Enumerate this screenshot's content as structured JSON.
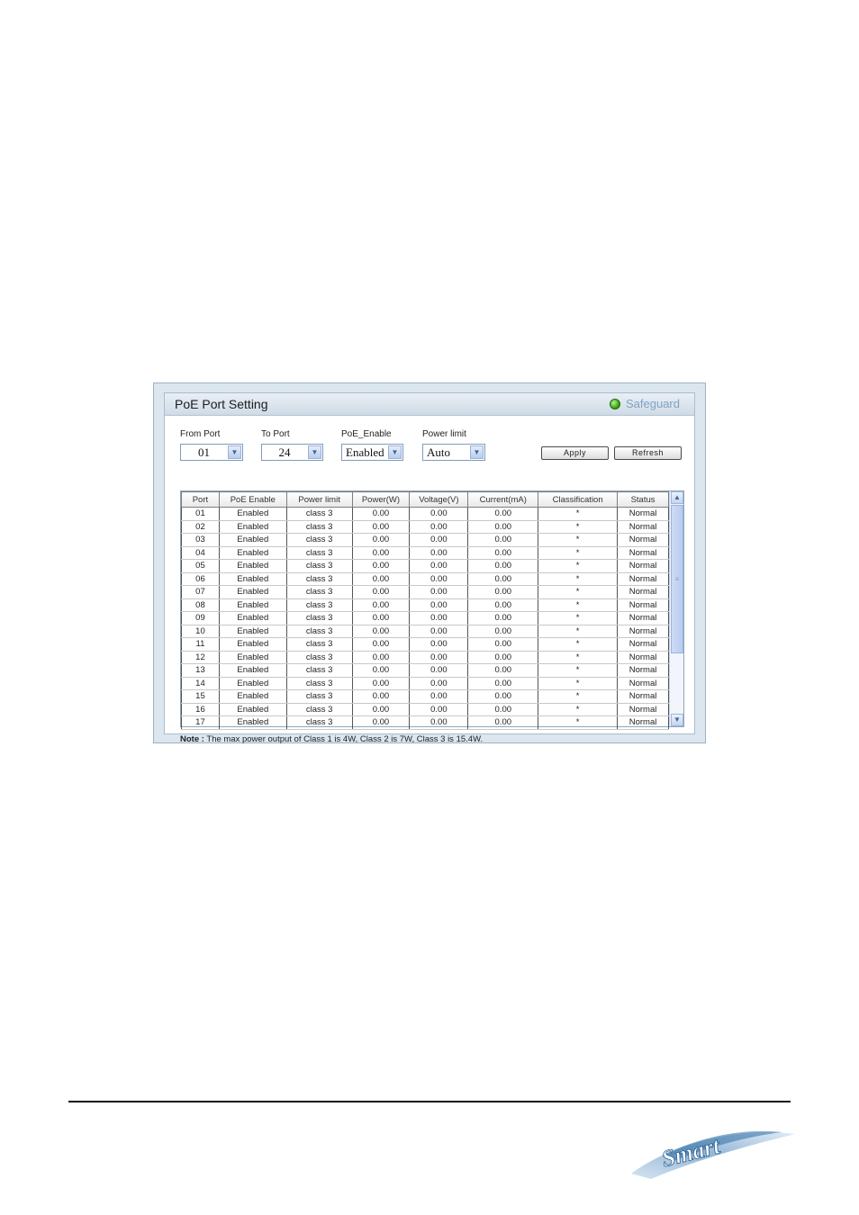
{
  "panel": {
    "title": "PoE Port Setting",
    "safeguard_label": "Safeguard"
  },
  "controls": {
    "from_port": {
      "label": "From Port",
      "value": "01"
    },
    "to_port": {
      "label": "To Port",
      "value": "24"
    },
    "poe_enable": {
      "label": "PoE_Enable",
      "value": "Enabled"
    },
    "power_limit": {
      "label": "Power limit",
      "value": "Auto"
    },
    "apply_label": "Apply",
    "refresh_label": "Refresh"
  },
  "table": {
    "columns": [
      "Port",
      "PoE Enable",
      "Power limit",
      "Power(W)",
      "Voltage(V)",
      "Current(mA)",
      "Classification",
      "Status"
    ],
    "rows": [
      [
        "01",
        "Enabled",
        "class 3",
        "0.00",
        "0.00",
        "0.00",
        "*",
        "Normal"
      ],
      [
        "02",
        "Enabled",
        "class 3",
        "0.00",
        "0.00",
        "0.00",
        "*",
        "Normal"
      ],
      [
        "03",
        "Enabled",
        "class 3",
        "0.00",
        "0.00",
        "0.00",
        "*",
        "Normal"
      ],
      [
        "04",
        "Enabled",
        "class 3",
        "0.00",
        "0.00",
        "0.00",
        "*",
        "Normal"
      ],
      [
        "05",
        "Enabled",
        "class 3",
        "0.00",
        "0.00",
        "0.00",
        "*",
        "Normal"
      ],
      [
        "06",
        "Enabled",
        "class 3",
        "0.00",
        "0.00",
        "0.00",
        "*",
        "Normal"
      ],
      [
        "07",
        "Enabled",
        "class 3",
        "0.00",
        "0.00",
        "0.00",
        "*",
        "Normal"
      ],
      [
        "08",
        "Enabled",
        "class 3",
        "0.00",
        "0.00",
        "0.00",
        "*",
        "Normal"
      ],
      [
        "09",
        "Enabled",
        "class 3",
        "0.00",
        "0.00",
        "0.00",
        "*",
        "Normal"
      ],
      [
        "10",
        "Enabled",
        "class 3",
        "0.00",
        "0.00",
        "0.00",
        "*",
        "Normal"
      ],
      [
        "11",
        "Enabled",
        "class 3",
        "0.00",
        "0.00",
        "0.00",
        "*",
        "Normal"
      ],
      [
        "12",
        "Enabled",
        "class 3",
        "0.00",
        "0.00",
        "0.00",
        "*",
        "Normal"
      ],
      [
        "13",
        "Enabled",
        "class 3",
        "0.00",
        "0.00",
        "0.00",
        "*",
        "Normal"
      ],
      [
        "14",
        "Enabled",
        "class 3",
        "0.00",
        "0.00",
        "0.00",
        "*",
        "Normal"
      ],
      [
        "15",
        "Enabled",
        "class 3",
        "0.00",
        "0.00",
        "0.00",
        "*",
        "Normal"
      ],
      [
        "16",
        "Enabled",
        "class 3",
        "0.00",
        "0.00",
        "0.00",
        "*",
        "Normal"
      ],
      [
        "17",
        "Enabled",
        "class 3",
        "0.00",
        "0.00",
        "0.00",
        "*",
        "Normal"
      ]
    ]
  },
  "note": {
    "prefix": "Note :",
    "text": " The max power output of Class 1 is 4W, Class 2 is 7W, Class 3 is 15.4W."
  },
  "footer": {
    "logo_text": "Smart"
  },
  "colors": {
    "status_led": "#2f9a10",
    "safeguard_text": "#7fa3c6",
    "frame_bg": "#dbe6ef"
  },
  "icons": {
    "dropdown": "chevron-down-icon",
    "scroll_up": "scroll-up-icon",
    "scroll_down": "scroll-down-icon",
    "led": "status-led-icon"
  }
}
